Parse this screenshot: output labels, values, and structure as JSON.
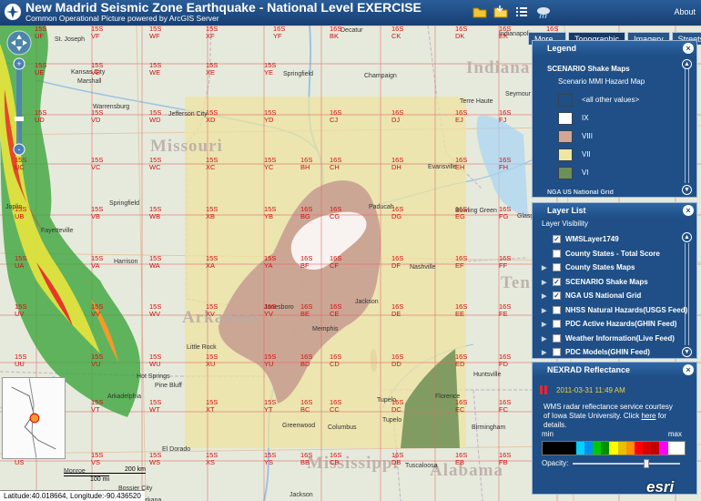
{
  "header": {
    "title": "New Madrid Seismic Zone Earthquake - National Level EXERCISE",
    "subtitle": "Common Operational Picture powered by ArcGIS Server",
    "about_label": "About"
  },
  "basemap_tabs": [
    {
      "label": "More...",
      "active": false
    },
    {
      "label": "Topographic",
      "active": true
    },
    {
      "label": "Imagery",
      "active": false
    },
    {
      "label": "Streets",
      "active": false
    }
  ],
  "legend": {
    "title": "Legend",
    "layer_name": "SCENARIO Shake Maps",
    "sub_name": "Scenario MMI Hazard Map",
    "items": [
      {
        "label": "<all other values>",
        "color": "#1f4f86"
      },
      {
        "label": "IX",
        "color": "#ffffff"
      },
      {
        "label": "VIII",
        "color": "#d2a597"
      },
      {
        "label": "VII",
        "color": "#f0e6a0"
      },
      {
        "label": "VI",
        "color": "#6e8f55"
      }
    ],
    "cutoff_label": "NGA US National Grid"
  },
  "layer_list": {
    "title": "Layer List",
    "visibility_label": "Layer Visibility",
    "layers": [
      {
        "label": "WMSLayer1749",
        "checked": true,
        "expandable": false
      },
      {
        "label": "County States - Total Score",
        "checked": false,
        "expandable": false
      },
      {
        "label": "County States Maps",
        "checked": false,
        "expandable": true
      },
      {
        "label": "SCENARIO Shake Maps",
        "checked": true,
        "expandable": true
      },
      {
        "label": "NGA US National Grid",
        "checked": true,
        "expandable": true
      },
      {
        "label": "NHSS Natural Hazards(USGS Feed)",
        "checked": false,
        "expandable": true
      },
      {
        "label": "PDC Active Hazards(GHIN Feed)",
        "checked": false,
        "expandable": true
      },
      {
        "label": "Weather Information(Live Feed)",
        "checked": false,
        "expandable": true
      },
      {
        "label": "PDC Models(GHIN Feed)",
        "checked": false,
        "expandable": true
      }
    ]
  },
  "nexrad": {
    "title": "NEXRAD Reflectance",
    "timestamp": "2011-03-31 11:49 AM",
    "description_pre": "WMS radar reflectance service courtesy of Iowa State University. Click ",
    "description_link": "here",
    "description_post": " for details.",
    "min_label": "min",
    "max_label": "max",
    "opacity_label": "Opacity:",
    "opacity_value": 0.7,
    "colors": [
      "#000000",
      "#000000",
      "#000000",
      "#000000",
      "#02d1ff",
      "#0090f0",
      "#00c800",
      "#009000",
      "#ffff00",
      "#e7c000",
      "#ff9000",
      "#ff0000",
      "#d60000",
      "#c00000",
      "#ff00ff",
      "#ffffff",
      "#ffffff"
    ]
  },
  "status": {
    "coordinates": "Latitude:40.018664, Longitude:-90.436520"
  },
  "scale": {
    "km_label": "200 km",
    "mi_label": "100 mi"
  },
  "branding": {
    "esri_label": "esri"
  },
  "map": {
    "states": [
      {
        "label": "Missouri"
      },
      {
        "label": "Indiana"
      },
      {
        "label": "Tennessee"
      },
      {
        "label": "Arkansas"
      },
      {
        "label": "Mississippi"
      },
      {
        "label": "Alabama"
      }
    ],
    "cities": [
      {
        "label": "St. Joseph"
      },
      {
        "label": "Kansas City"
      },
      {
        "label": "Marshall"
      },
      {
        "label": "Warrensburg"
      },
      {
        "label": "Jefferson City"
      },
      {
        "label": "Springfield"
      },
      {
        "label": "Joplin"
      },
      {
        "label": "Harrison"
      },
      {
        "label": "Decatur"
      },
      {
        "label": "Springfield"
      },
      {
        "label": "Champaign"
      },
      {
        "label": "Indianapolis"
      },
      {
        "label": "Terre Haute"
      },
      {
        "label": "Seymour"
      },
      {
        "label": "Evansville"
      },
      {
        "label": "Paducah"
      },
      {
        "label": "Nashville"
      },
      {
        "label": "Memphis"
      },
      {
        "label": "Jackson"
      },
      {
        "label": "Little Rock"
      },
      {
        "label": "Huntsville"
      },
      {
        "label": "Birmingham"
      },
      {
        "label": "Tupelo"
      },
      {
        "label": "Columbus"
      },
      {
        "label": "Greenwood"
      },
      {
        "label": "El Dorado"
      },
      {
        "label": "Monroe"
      },
      {
        "label": "Tuscaloosa"
      },
      {
        "label": "Pine Bluff"
      },
      {
        "label": "Fayetteville"
      },
      {
        "label": "Jonesboro"
      },
      {
        "label": "Florence"
      },
      {
        "label": "Tupelo"
      },
      {
        "label": "Bowling Green"
      },
      {
        "label": "Glasgow"
      },
      {
        "label": "Texarkana"
      },
      {
        "label": "Shreveport"
      },
      {
        "label": "Bossier City"
      },
      {
        "label": "Jackson"
      },
      {
        "label": "Hot Springs"
      },
      {
        "label": "Arkadelphia"
      }
    ],
    "grid_labels": [
      {
        "zone": "15S",
        "square": "UF"
      },
      {
        "zone": "15S",
        "square": "VF"
      },
      {
        "zone": "15S",
        "square": "WF"
      },
      {
        "zone": "15S",
        "square": "XF"
      },
      {
        "zone": "16S",
        "square": "YF"
      },
      {
        "zone": "16S",
        "square": "BK"
      },
      {
        "zone": "16S",
        "square": "CK"
      },
      {
        "zone": "16S",
        "square": "DK"
      },
      {
        "zone": "16S",
        "square": "EK"
      },
      {
        "zone": "16S",
        "square": "FK"
      },
      {
        "zone": "15S",
        "square": "UE"
      },
      {
        "zone": "15S",
        "square": "VE"
      },
      {
        "zone": "15S",
        "square": "WE"
      },
      {
        "zone": "15S",
        "square": "XE"
      },
      {
        "zone": "15S",
        "square": "YE"
      },
      {
        "zone": "15S",
        "square": "UD"
      },
      {
        "zone": "15S",
        "square": "VD"
      },
      {
        "zone": "15S",
        "square": "WD"
      },
      {
        "zone": "15S",
        "square": "XD"
      },
      {
        "zone": "15S",
        "square": "YD"
      },
      {
        "zone": "16S",
        "square": "CJ"
      },
      {
        "zone": "16S",
        "square": "DJ"
      },
      {
        "zone": "16S",
        "square": "EJ"
      },
      {
        "zone": "16S",
        "square": "FJ"
      },
      {
        "zone": "15S",
        "square": "UC"
      },
      {
        "zone": "15S",
        "square": "VC"
      },
      {
        "zone": "15S",
        "square": "WC"
      },
      {
        "zone": "15S",
        "square": "XC"
      },
      {
        "zone": "15S",
        "square": "YC"
      },
      {
        "zone": "16S",
        "square": "BH"
      },
      {
        "zone": "16S",
        "square": "CH"
      },
      {
        "zone": "16S",
        "square": "DH"
      },
      {
        "zone": "16S",
        "square": "EH"
      },
      {
        "zone": "16S",
        "square": "FH"
      },
      {
        "zone": "15S",
        "square": "UB"
      },
      {
        "zone": "15S",
        "square": "VB"
      },
      {
        "zone": "15S",
        "square": "WB"
      },
      {
        "zone": "15S",
        "square": "XB"
      },
      {
        "zone": "15S",
        "square": "YB"
      },
      {
        "zone": "16S",
        "square": "BG"
      },
      {
        "zone": "16S",
        "square": "CG"
      },
      {
        "zone": "16S",
        "square": "DG"
      },
      {
        "zone": "16S",
        "square": "EG"
      },
      {
        "zone": "16S",
        "square": "FG"
      },
      {
        "zone": "15S",
        "square": "UA"
      },
      {
        "zone": "15S",
        "square": "VA"
      },
      {
        "zone": "15S",
        "square": "WA"
      },
      {
        "zone": "15S",
        "square": "XA"
      },
      {
        "zone": "15S",
        "square": "YA"
      },
      {
        "zone": "16S",
        "square": "BF"
      },
      {
        "zone": "16S",
        "square": "CF"
      },
      {
        "zone": "16S",
        "square": "DF"
      },
      {
        "zone": "16S",
        "square": "EF"
      },
      {
        "zone": "16S",
        "square": "FF"
      },
      {
        "zone": "15S",
        "square": "UV"
      },
      {
        "zone": "15S",
        "square": "VV"
      },
      {
        "zone": "15S",
        "square": "WV"
      },
      {
        "zone": "15S",
        "square": "XV"
      },
      {
        "zone": "15S",
        "square": "YV"
      },
      {
        "zone": "16S",
        "square": "BE"
      },
      {
        "zone": "16S",
        "square": "CE"
      },
      {
        "zone": "16S",
        "square": "DE"
      },
      {
        "zone": "16S",
        "square": "EE"
      },
      {
        "zone": "16S",
        "square": "FE"
      },
      {
        "zone": "15S",
        "square": "UU"
      },
      {
        "zone": "15S",
        "square": "VU"
      },
      {
        "zone": "15S",
        "square": "WU"
      },
      {
        "zone": "15S",
        "square": "XU"
      },
      {
        "zone": "15S",
        "square": "YU"
      },
      {
        "zone": "16S",
        "square": "BD"
      },
      {
        "zone": "16S",
        "square": "CD"
      },
      {
        "zone": "16S",
        "square": "DD"
      },
      {
        "zone": "16S",
        "square": "ED"
      },
      {
        "zone": "16S",
        "square": "FD"
      },
      {
        "zone": "15S",
        "square": "UT"
      },
      {
        "zone": "15S",
        "square": "VT"
      },
      {
        "zone": "15S",
        "square": "WT"
      },
      {
        "zone": "15S",
        "square": "XT"
      },
      {
        "zone": "15S",
        "square": "YT"
      },
      {
        "zone": "16S",
        "square": "BC"
      },
      {
        "zone": "16S",
        "square": "CC"
      },
      {
        "zone": "16S",
        "square": "DC"
      },
      {
        "zone": "16S",
        "square": "EC"
      },
      {
        "zone": "16S",
        "square": "FC"
      },
      {
        "zone": "15S",
        "square": "US"
      },
      {
        "zone": "15S",
        "square": "VS"
      },
      {
        "zone": "15S",
        "square": "WS"
      },
      {
        "zone": "15S",
        "square": "XS"
      },
      {
        "zone": "15S",
        "square": "YS"
      },
      {
        "zone": "16S",
        "square": "BB"
      },
      {
        "zone": "16S",
        "square": "CB"
      },
      {
        "zone": "16S",
        "square": "DB"
      },
      {
        "zone": "16S",
        "square": "EB"
      },
      {
        "zone": "16S",
        "square": "FB"
      }
    ]
  }
}
